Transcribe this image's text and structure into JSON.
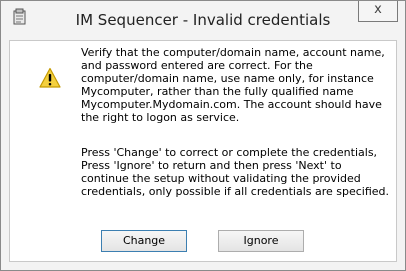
{
  "window": {
    "title": "IM Sequencer - Invalid credentials",
    "close_label": "x"
  },
  "icons": {
    "app": "app-icon",
    "warning": "warning-icon",
    "close": "close-icon"
  },
  "message": {
    "paragraph1": [
      "Verify that the computer/domain name, account name,",
      "and password entered are correct. For the",
      "computer/domain name, use name only, for instance",
      "Mycomputer, rather than the fully qualified name",
      "Mycomputer.Mydomain.com. The account should have",
      "the right to logon as service."
    ],
    "paragraph2": [
      "Press 'Change' to correct or complete the credentials,",
      "Press 'Ignore' to return and then press 'Next' to",
      "continue the setup without validating the provided",
      "credentials, only possible if all credentials are specified."
    ]
  },
  "buttons": {
    "change": "Change",
    "ignore": "Ignore"
  },
  "colors": {
    "warning_fill": "#f4d03f",
    "warning_border": "#c49a00",
    "focus_border": "#3c7fb1"
  }
}
